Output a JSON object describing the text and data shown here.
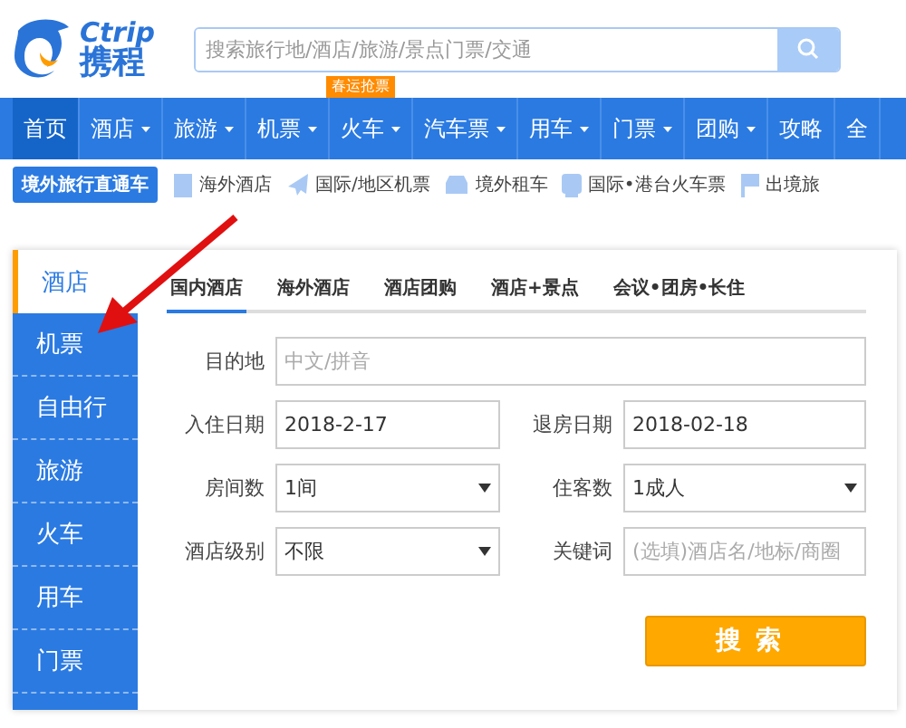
{
  "logo": {
    "latin": "Ctrip",
    "name": "携程"
  },
  "search": {
    "placeholder": "搜索旅行地/酒店/旅游/景点门票/交通"
  },
  "nav": [
    {
      "label": "首页",
      "selected": true,
      "dropdown": false
    },
    {
      "label": "酒店",
      "selected": false,
      "dropdown": true
    },
    {
      "label": "旅游",
      "selected": false,
      "dropdown": true
    },
    {
      "label": "机票",
      "selected": false,
      "dropdown": true
    },
    {
      "label": "火车",
      "selected": false,
      "dropdown": true,
      "badge": "春运抢票"
    },
    {
      "label": "汽车票",
      "selected": false,
      "dropdown": true
    },
    {
      "label": "用车",
      "selected": false,
      "dropdown": true
    },
    {
      "label": "门票",
      "selected": false,
      "dropdown": true
    },
    {
      "label": "团购",
      "selected": false,
      "dropdown": true
    },
    {
      "label": "攻略",
      "selected": false,
      "dropdown": false
    },
    {
      "label": "全",
      "selected": false,
      "dropdown": false
    }
  ],
  "subnav": {
    "title": "境外旅行直通车",
    "links": [
      {
        "kind": "hotel",
        "label": "海外酒店"
      },
      {
        "kind": "plane",
        "label": "国际/地区机票"
      },
      {
        "kind": "car",
        "label": "境外租车"
      },
      {
        "kind": "train",
        "label": "国际•港台火车票"
      },
      {
        "kind": "flag",
        "label": "出境旅"
      }
    ]
  },
  "sidebar": [
    {
      "label": "酒店",
      "selected": true
    },
    {
      "label": "机票",
      "selected": false
    },
    {
      "label": "自由行",
      "selected": false
    },
    {
      "label": "旅游",
      "selected": false
    },
    {
      "label": "火车",
      "selected": false
    },
    {
      "label": "用车",
      "selected": false
    },
    {
      "label": "门票",
      "selected": false
    }
  ],
  "tabs": [
    {
      "label": "国内酒店",
      "selected": true
    },
    {
      "label": "海外酒店",
      "selected": false
    },
    {
      "label": "酒店团购",
      "selected": false
    },
    {
      "label": "酒店+景点",
      "selected": false
    },
    {
      "label": "会议•团房•长住",
      "selected": false
    }
  ],
  "form": {
    "destination": {
      "label": "目的地",
      "placeholder": "中文/拼音"
    },
    "rows": [
      [
        {
          "kind": "text",
          "label": "入住日期",
          "value": "2018-2-17"
        },
        {
          "kind": "text",
          "label": "退房日期",
          "value": "2018-02-18"
        }
      ],
      [
        {
          "kind": "select",
          "label": "房间数",
          "value": "1间"
        },
        {
          "kind": "select",
          "label": "住客数",
          "value": "1成人"
        }
      ],
      [
        {
          "kind": "select",
          "label": "酒店级别",
          "value": "不限"
        },
        {
          "kind": "text",
          "label": "关键词",
          "placeholder": "(选填)酒店名/地标/商圈"
        }
      ]
    ],
    "submit": "搜索"
  }
}
